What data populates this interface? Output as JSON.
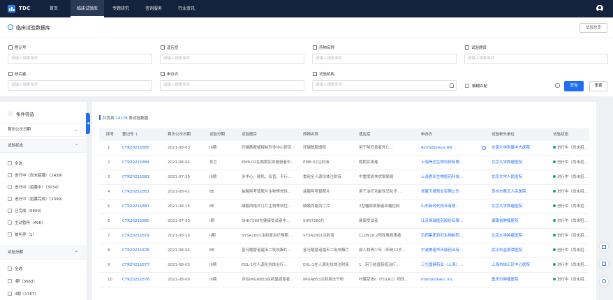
{
  "header": {
    "brand": "TDC",
    "nav": [
      "首页",
      "临床试验库",
      "专题研究",
      "咨询服务",
      "行业资讯"
    ],
    "active_nav": "临床试验库"
  },
  "search": {
    "page_title": "临床试验数据库",
    "top_button": "试验总览",
    "fields": [
      {
        "label": "登记号",
        "icon": "tag-icon",
        "placeholder": "请输入搜索条件"
      },
      {
        "label": "适应症",
        "icon": "checkbox-icon",
        "placeholder": "请输入搜索条件"
      },
      {
        "label": "药物名称",
        "icon": "link-icon",
        "placeholder": "请输入搜索条件"
      },
      {
        "label": "试验题目",
        "icon": "document-icon",
        "placeholder": "请输入搜索条件"
      },
      {
        "label": "研究者",
        "icon": "person-icon",
        "placeholder": "请输入搜索条件"
      },
      {
        "label": "申办方",
        "icon": "person-icon",
        "placeholder": "请输入搜索条件"
      },
      {
        "label": "试验机构",
        "icon": "building-icon",
        "placeholder": "请输入搜索条件"
      }
    ],
    "fuzzy_label": "模糊匹配",
    "query_button": "查询",
    "reset_button": "重置"
  },
  "filters": {
    "title": "条件筛选",
    "sections": [
      {
        "label": "首次公示日期",
        "expanded": false
      },
      {
        "label": "试验状态",
        "expanded": true,
        "options": [
          "全选",
          "进行中（尚未招募）（2439）",
          "进行中（招募中）（3034）",
          "进行中（招募完成）（1399）",
          "已完成（6809）",
          "主动暂停（496）",
          "被叫停（1）"
        ]
      },
      {
        "label": "试验分期",
        "expanded": true,
        "options": [
          "全选",
          "I期（3663）",
          "II期（1787）"
        ]
      }
    ]
  },
  "results": {
    "prefix": "共找到",
    "count": "14178",
    "suffix": "条试验数据",
    "columns": [
      "序号",
      "登记号",
      "首次公示日期",
      "试验分期",
      "试验题目",
      "药物名称",
      "适应症",
      "申办方",
      "试验牵头单位",
      "试验状态"
    ],
    "rows": [
      {
        "no": "1",
        "id": "CTR20211885",
        "date": "2021-08-03",
        "phase": "III期",
        "title": "环磷酰胺缓释制剂多中心研究",
        "drug": "环磷酰胺缓释",
        "indication": "用于降低患者死亡…",
        "sponsor": "AstraZeneca AB",
        "lead": "东南大学附属中大医院",
        "status": "进行中（尚未招募）"
      },
      {
        "no": "2",
        "id": "CTR20211884",
        "date": "2021-08-04",
        "phase": "其它",
        "title": "EMB-02在晚期实体瘤患者中…",
        "drug": "EMB-02注射液",
        "indication": "晚期实体瘤",
        "sponsor": "上海岸迈生物科技有限…",
        "lead": "北京大学肿瘤医院",
        "status": "进行中（尚未招募）"
      },
      {
        "no": "3",
        "id": "CTR20211883",
        "date": "2021-07-30",
        "phase": "III期",
        "title": "多中心、随机、双盲、平行…",
        "drug": "重组全人源抗体注射液",
        "indication": "中重度斑块状银屑病",
        "sponsor": "上海君实生物医药科技…",
        "lead": "北京大学人民医院",
        "status": "进行中（尚未招募）"
      },
      {
        "no": "4",
        "id": "CTR20211882",
        "date": "2021-08-02",
        "phase": "BE",
        "title": "盐酸阿考替胺片生物等效性…",
        "drug": "盐酸阿考替胺片",
        "indication": "用于治疗功能性消化不…",
        "sponsor": "浙夏天晴药业有限公司",
        "lead": "苏州市第五人民医院",
        "status": "进行中（尚未招募）"
      },
      {
        "no": "5",
        "id": "CTR20211881",
        "date": "2021-08-13",
        "phase": "BE",
        "title": "磷酸西格列汀片生物等效性…",
        "drug": "磷酸西格列汀片",
        "indication": "2型糖尿病患者血糖控制",
        "sponsor": "山东新时代药业有限…",
        "lead": "北京大学肿瘤医院",
        "status": "进行中（尚未招募）"
      },
      {
        "no": "6",
        "id": "CTR20211880",
        "date": "2021-07-30",
        "phase": "I期",
        "title": "SHR7280在健康受试者中…",
        "drug": "SHR7280片",
        "indication": "健康受试者",
        "sponsor": "江苏恒瑞医药股份有限…",
        "lead": "湖南省肿瘤医院",
        "status": "进行中（尚未招募）"
      },
      {
        "no": "7",
        "id": "CTR20211879",
        "date": "2021-08-16",
        "phase": "II期",
        "title": "SYSA1801注射液治疗晚期…",
        "drug": "SYSA1801注射液",
        "indication": "CLDN18.2阳性胃癌患者",
        "sponsor": "石药集团巨石生物制药…",
        "lead": "北京大学肿瘤医院",
        "status": "进行中（尚未招募）"
      },
      {
        "no": "8",
        "id": "CTR20211878",
        "date": "2021-08-04",
        "phase": "BE",
        "title": "富马酸替诺福韦二吡呋酯片…",
        "drug": "富马酸替诺福韦二吡呋酯片",
        "indication": "成人和青少年（年龄12岁…",
        "sponsor": "宁波美诺华天康药业有…",
        "lead": "武汉市金银潭医院",
        "status": "进行中（尚未招募）"
      },
      {
        "no": "9",
        "id": "CTR20211877",
        "date": "2021-08-03",
        "phase": "III期",
        "title": "EGL-1在人源化抗体治疗…",
        "drug": "EGL-1在人源化抗体注射液",
        "indication": "1、用于结直肠癌治疗…",
        "sponsor": "三生国健药业（上海）…",
        "lead": "上海市徐汇区中心医院",
        "status": "进行中（尚未招募）"
      },
      {
        "no": "10",
        "id": "CTR20211876",
        "date": "2021-08-09",
        "phase": "III期",
        "title": "评估IMGN853在卵巢癌患者…",
        "drug": "IMGN853注射用冻干粉",
        "indication": "叶酸受体α（FOLR1）阳性…",
        "sponsor": "ImmunoGen, Inc.",
        "lead": "重庆市肿瘤医院",
        "status": "进行中（尚未招募）"
      }
    ]
  },
  "colors": {
    "topbar": "#13223d",
    "accent": "#1f6ff5",
    "status": "#19a364"
  },
  "floating_icons": [
    "headset-icon",
    "clipboard-icon",
    "arrow-up-icon"
  ]
}
